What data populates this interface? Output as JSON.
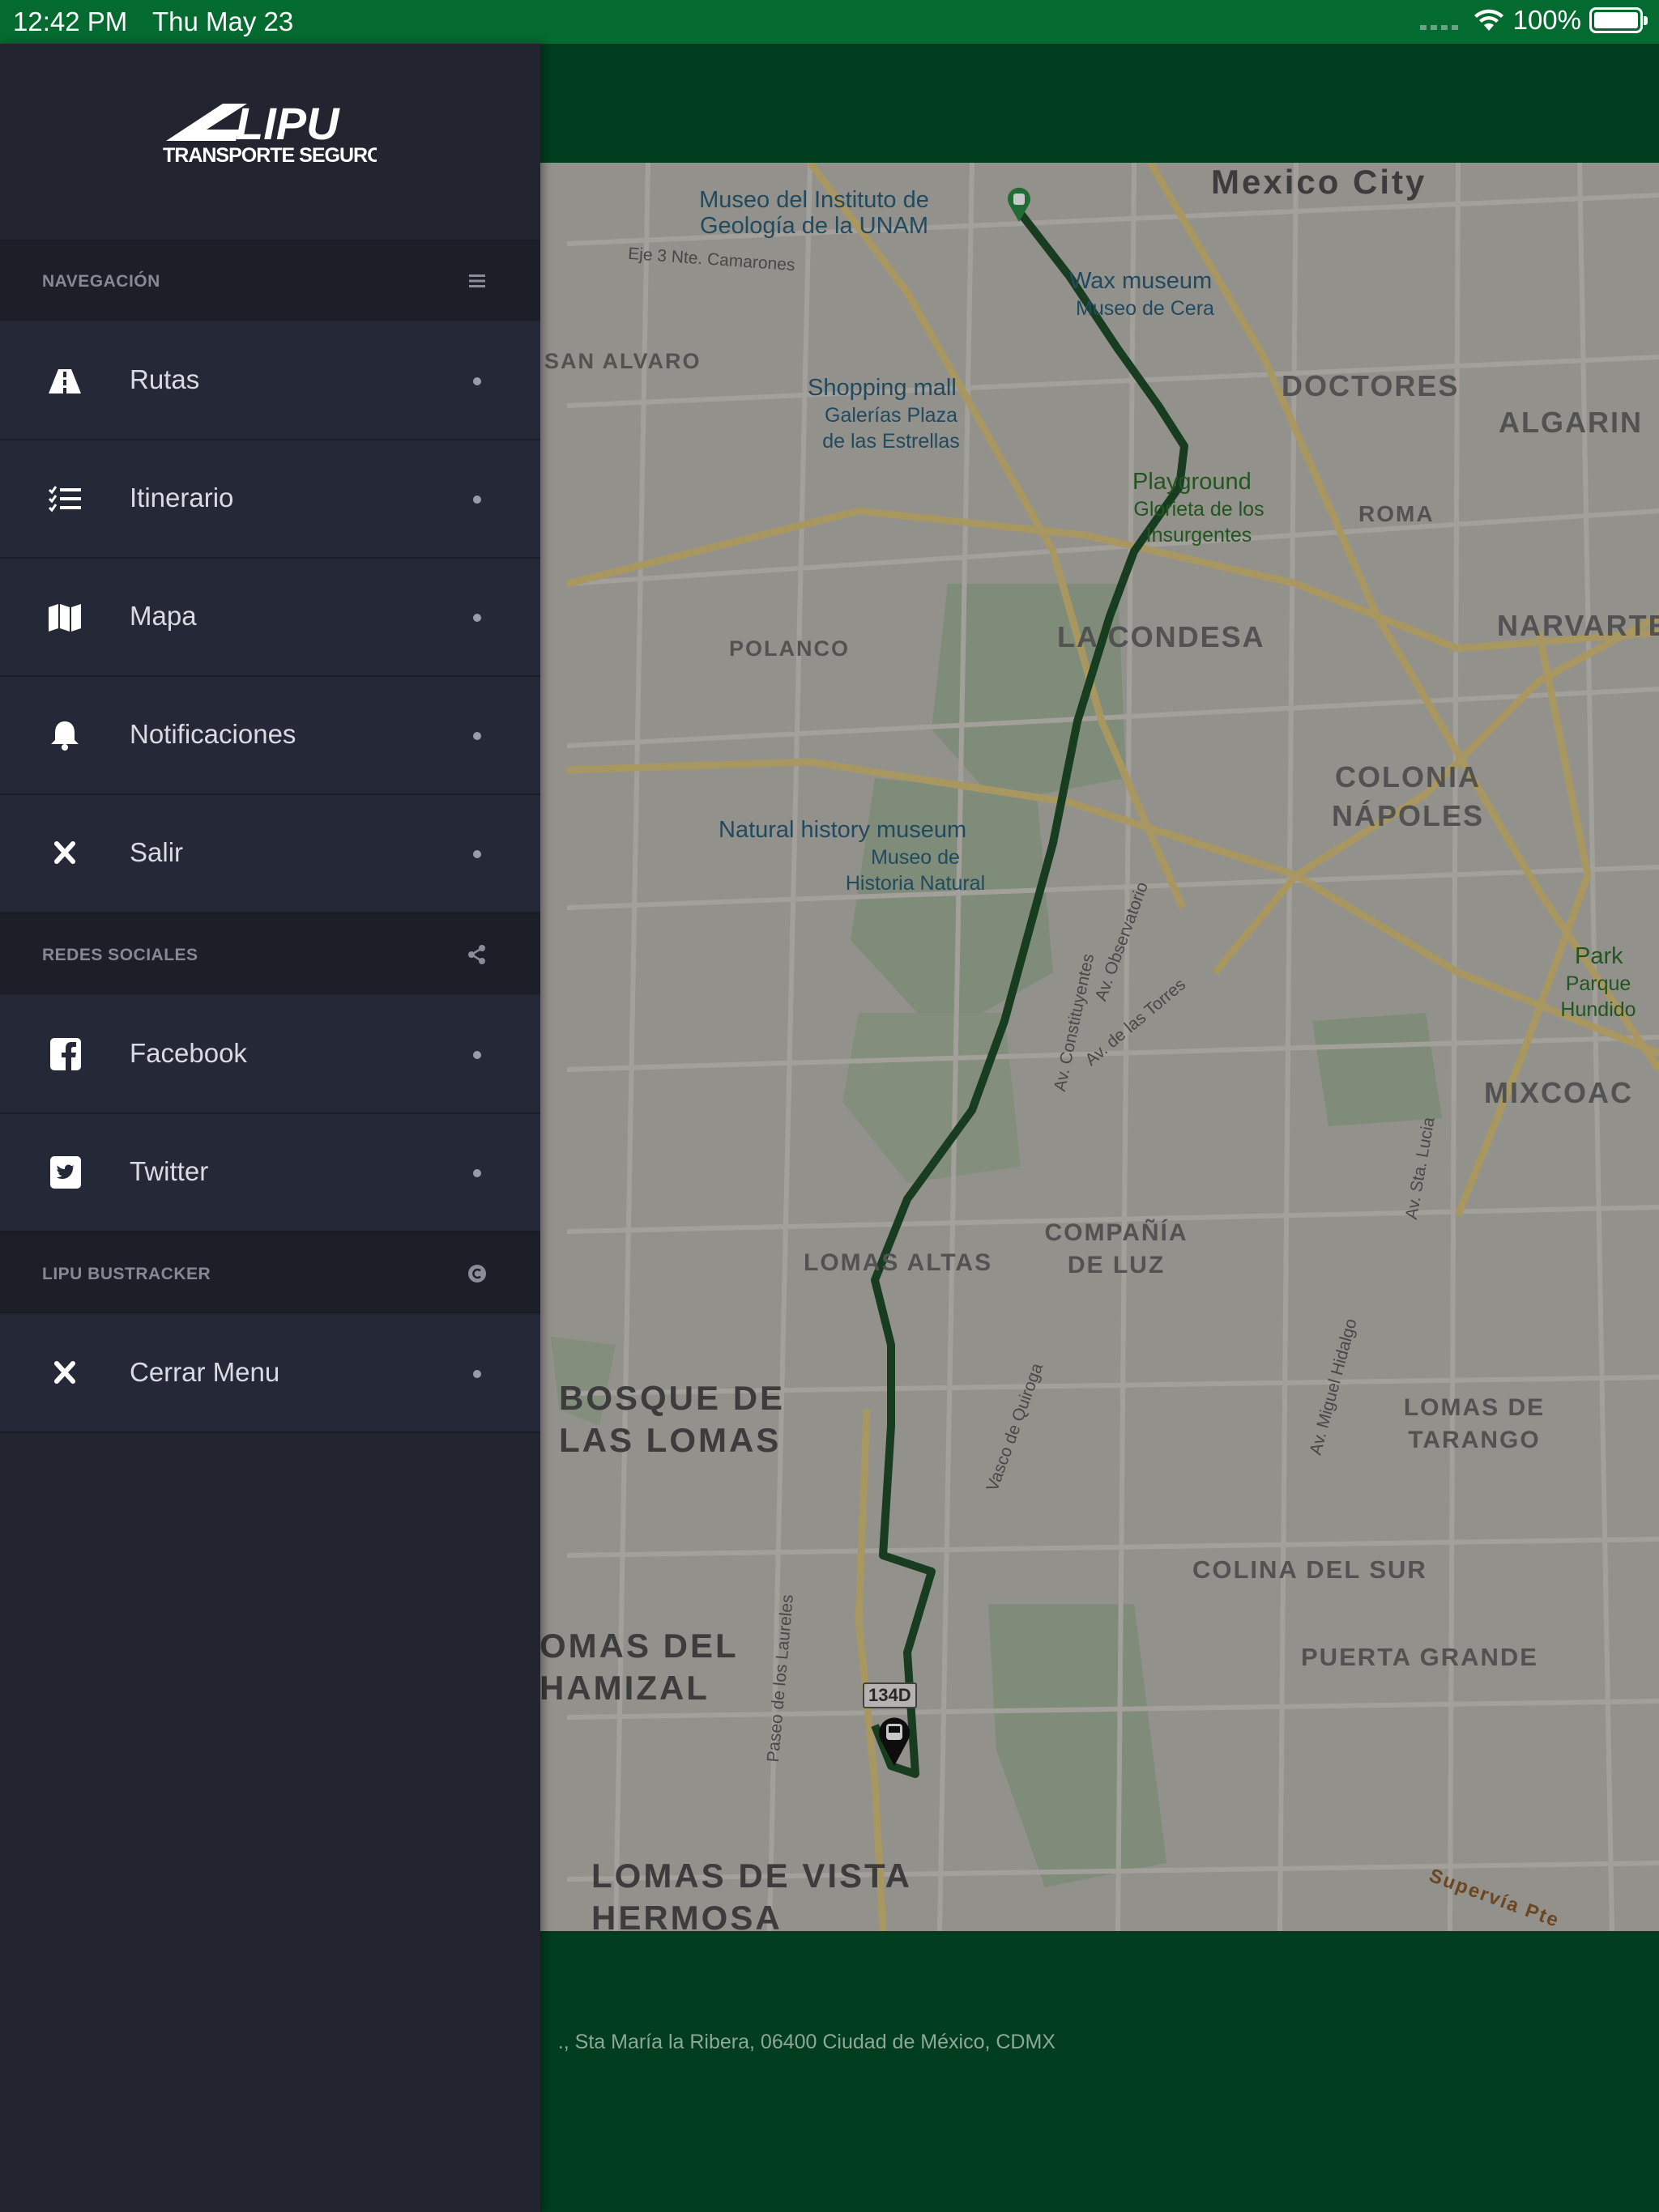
{
  "status_bar": {
    "time": "12:42 PM",
    "date": "Thu May 23",
    "battery": "100%"
  },
  "brand": {
    "logo_name": "LIPU",
    "tagline": "TRANSPORTE SEGURO"
  },
  "drawer": {
    "sections": [
      {
        "title": "NAVEGACIÓN",
        "icon": "list-icon",
        "items": [
          {
            "label": "Rutas",
            "icon": "road-icon"
          },
          {
            "label": "Itinerario",
            "icon": "checklist-icon"
          },
          {
            "label": "Mapa",
            "icon": "map-icon"
          },
          {
            "label": "Notificaciones",
            "icon": "bell-icon"
          },
          {
            "label": "Salir",
            "icon": "close-icon"
          }
        ]
      },
      {
        "title": "REDES SOCIALES",
        "icon": "share-icon",
        "items": [
          {
            "label": "Facebook",
            "icon": "facebook-icon"
          },
          {
            "label": "Twitter",
            "icon": "twitter-icon"
          }
        ]
      },
      {
        "title": "LIPU BUSTRACKER",
        "icon": "copyright-icon",
        "items": [
          {
            "label": "Cerrar Menu",
            "icon": "close-icon"
          }
        ]
      }
    ]
  },
  "map": {
    "labels": {
      "mexico_city": "Mexico City",
      "san_alvaro": "SAN ALVARO",
      "doctores": "DOCTORES",
      "algarin": "ALGARIN",
      "roma": "ROMA",
      "polanco": "POLANCO",
      "la_condesa": "LA CONDESA",
      "narvarte": "NARVARTE PONIENTE",
      "colonia_napoles": "COLONIA NÁPOLES",
      "mixcoac": "MIXCOAC",
      "lomas_altas": "LOMAS ALTAS",
      "compania_de_luz": "COMPAÑÍA DE LUZ",
      "bosque_de_las_lomas": "BOSQUE DE LAS LOMAS",
      "lomas_de_tarango": "LOMAS DE TARANGO",
      "colina_del_sur": "COLINA DEL SUR",
      "puerta_grande": "PUERTA GRANDE",
      "lomas_del_chamizal": "OMAS DEL HAMIZAL",
      "lomas_de_vista_hermosa": "LOMAS DE VISTA HERMOSA",
      "museo_geologia": "Museo del Instituto de Geología de la UNAM",
      "wax_museum": "Wax museum",
      "museo_cera": "Museo de Cera",
      "shopping_mall": "Shopping mall",
      "galerias": "Galerías Plaza de las Estrellas",
      "playground": "Playground",
      "glorieta": "Glorieta de los Insurgentes",
      "natural_history": "Natural history museum",
      "museo_historia": "Museo de Historia Natural",
      "park": "Park",
      "parque_hundido": "Parque Hundido",
      "av_constituyentes": "Av. Constituyentes",
      "av_observatorio": "Av. Observatorio",
      "av_de_las_torres": "Av. de las Torres",
      "vasco_de_quiroga": "Vasco de Quiroga",
      "paseo_laureles": "Paseo de los Laureles",
      "av_miguel_hidalgo": "Av. Miguel Hidalgo",
      "av_sta_lucia": "Av. Sta. Lucia",
      "eje3": "Eje 3 Nte. Camarones",
      "highway": "134D",
      "supervia": "Supervía Pte"
    }
  },
  "footer": {
    "address": "., Sta María la Ribera, 06400 Ciudad de México, CDMX"
  }
}
